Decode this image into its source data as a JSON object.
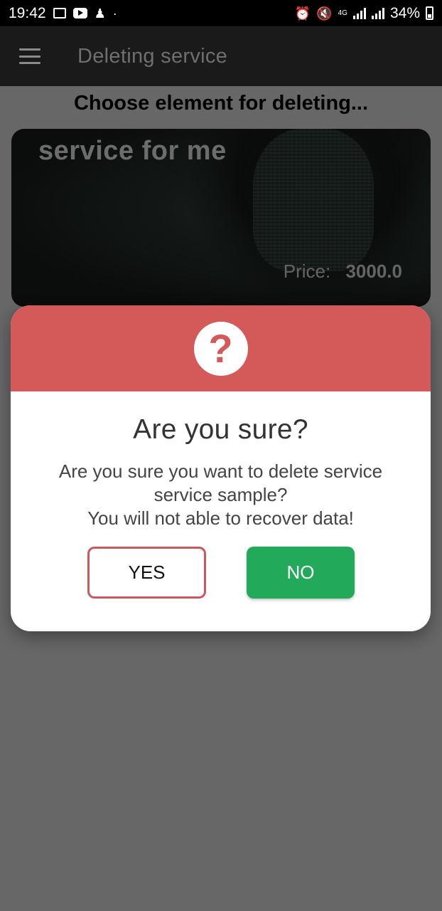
{
  "status_bar": {
    "time": "19:42",
    "battery": "34%",
    "network": "4G",
    "icons": [
      "image-icon",
      "youtube-icon",
      "notification-icon",
      "alarm-icon",
      "mute-icon",
      "signal-icon",
      "battery-icon"
    ]
  },
  "app_bar": {
    "title": "Deleting service",
    "menu_icon": "hamburger-menu-icon"
  },
  "page": {
    "heading": "Choose element for deleting..."
  },
  "service_card": {
    "title": "service for me",
    "price_label": "Price:",
    "price_value": "3000.0"
  },
  "dialog": {
    "icon": "question-mark-icon",
    "icon_glyph": "?",
    "title": "Are you sure?",
    "message_line1": "Are you sure you want to delete service",
    "message_line2": "service sample?",
    "message_line3": "You will not able to recover data!",
    "yes_label": "YES",
    "no_label": "NO"
  },
  "colors": {
    "dialog_header": "#D45A5A",
    "yes_border": "#C9585F",
    "no_button": "#22AA5A",
    "app_bar": "#1A1A1A",
    "status_bar": "#000000"
  }
}
